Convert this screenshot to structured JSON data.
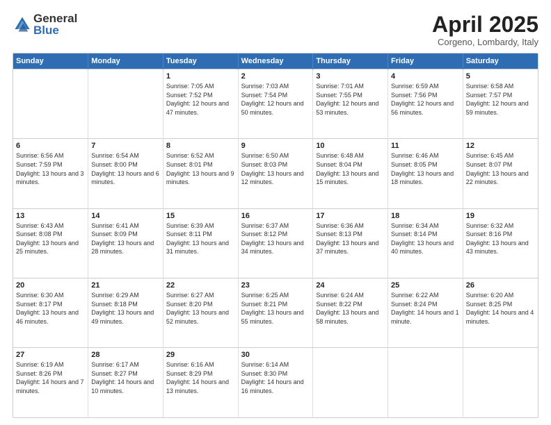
{
  "logo": {
    "general": "General",
    "blue": "Blue"
  },
  "title": "April 2025",
  "subtitle": "Corgeno, Lombardy, Italy",
  "days_of_week": [
    "Sunday",
    "Monday",
    "Tuesday",
    "Wednesday",
    "Thursday",
    "Friday",
    "Saturday"
  ],
  "weeks": [
    [
      {
        "day": "",
        "sunrise": "",
        "sunset": "",
        "daylight": ""
      },
      {
        "day": "",
        "sunrise": "",
        "sunset": "",
        "daylight": ""
      },
      {
        "day": "1",
        "sunrise": "Sunrise: 7:05 AM",
        "sunset": "Sunset: 7:52 PM",
        "daylight": "Daylight: 12 hours and 47 minutes."
      },
      {
        "day": "2",
        "sunrise": "Sunrise: 7:03 AM",
        "sunset": "Sunset: 7:54 PM",
        "daylight": "Daylight: 12 hours and 50 minutes."
      },
      {
        "day": "3",
        "sunrise": "Sunrise: 7:01 AM",
        "sunset": "Sunset: 7:55 PM",
        "daylight": "Daylight: 12 hours and 53 minutes."
      },
      {
        "day": "4",
        "sunrise": "Sunrise: 6:59 AM",
        "sunset": "Sunset: 7:56 PM",
        "daylight": "Daylight: 12 hours and 56 minutes."
      },
      {
        "day": "5",
        "sunrise": "Sunrise: 6:58 AM",
        "sunset": "Sunset: 7:57 PM",
        "daylight": "Daylight: 12 hours and 59 minutes."
      }
    ],
    [
      {
        "day": "6",
        "sunrise": "Sunrise: 6:56 AM",
        "sunset": "Sunset: 7:59 PM",
        "daylight": "Daylight: 13 hours and 3 minutes."
      },
      {
        "day": "7",
        "sunrise": "Sunrise: 6:54 AM",
        "sunset": "Sunset: 8:00 PM",
        "daylight": "Daylight: 13 hours and 6 minutes."
      },
      {
        "day": "8",
        "sunrise": "Sunrise: 6:52 AM",
        "sunset": "Sunset: 8:01 PM",
        "daylight": "Daylight: 13 hours and 9 minutes."
      },
      {
        "day": "9",
        "sunrise": "Sunrise: 6:50 AM",
        "sunset": "Sunset: 8:03 PM",
        "daylight": "Daylight: 13 hours and 12 minutes."
      },
      {
        "day": "10",
        "sunrise": "Sunrise: 6:48 AM",
        "sunset": "Sunset: 8:04 PM",
        "daylight": "Daylight: 13 hours and 15 minutes."
      },
      {
        "day": "11",
        "sunrise": "Sunrise: 6:46 AM",
        "sunset": "Sunset: 8:05 PM",
        "daylight": "Daylight: 13 hours and 18 minutes."
      },
      {
        "day": "12",
        "sunrise": "Sunrise: 6:45 AM",
        "sunset": "Sunset: 8:07 PM",
        "daylight": "Daylight: 13 hours and 22 minutes."
      }
    ],
    [
      {
        "day": "13",
        "sunrise": "Sunrise: 6:43 AM",
        "sunset": "Sunset: 8:08 PM",
        "daylight": "Daylight: 13 hours and 25 minutes."
      },
      {
        "day": "14",
        "sunrise": "Sunrise: 6:41 AM",
        "sunset": "Sunset: 8:09 PM",
        "daylight": "Daylight: 13 hours and 28 minutes."
      },
      {
        "day": "15",
        "sunrise": "Sunrise: 6:39 AM",
        "sunset": "Sunset: 8:11 PM",
        "daylight": "Daylight: 13 hours and 31 minutes."
      },
      {
        "day": "16",
        "sunrise": "Sunrise: 6:37 AM",
        "sunset": "Sunset: 8:12 PM",
        "daylight": "Daylight: 13 hours and 34 minutes."
      },
      {
        "day": "17",
        "sunrise": "Sunrise: 6:36 AM",
        "sunset": "Sunset: 8:13 PM",
        "daylight": "Daylight: 13 hours and 37 minutes."
      },
      {
        "day": "18",
        "sunrise": "Sunrise: 6:34 AM",
        "sunset": "Sunset: 8:14 PM",
        "daylight": "Daylight: 13 hours and 40 minutes."
      },
      {
        "day": "19",
        "sunrise": "Sunrise: 6:32 AM",
        "sunset": "Sunset: 8:16 PM",
        "daylight": "Daylight: 13 hours and 43 minutes."
      }
    ],
    [
      {
        "day": "20",
        "sunrise": "Sunrise: 6:30 AM",
        "sunset": "Sunset: 8:17 PM",
        "daylight": "Daylight: 13 hours and 46 minutes."
      },
      {
        "day": "21",
        "sunrise": "Sunrise: 6:29 AM",
        "sunset": "Sunset: 8:18 PM",
        "daylight": "Daylight: 13 hours and 49 minutes."
      },
      {
        "day": "22",
        "sunrise": "Sunrise: 6:27 AM",
        "sunset": "Sunset: 8:20 PM",
        "daylight": "Daylight: 13 hours and 52 minutes."
      },
      {
        "day": "23",
        "sunrise": "Sunrise: 6:25 AM",
        "sunset": "Sunset: 8:21 PM",
        "daylight": "Daylight: 13 hours and 55 minutes."
      },
      {
        "day": "24",
        "sunrise": "Sunrise: 6:24 AM",
        "sunset": "Sunset: 8:22 PM",
        "daylight": "Daylight: 13 hours and 58 minutes."
      },
      {
        "day": "25",
        "sunrise": "Sunrise: 6:22 AM",
        "sunset": "Sunset: 8:24 PM",
        "daylight": "Daylight: 14 hours and 1 minute."
      },
      {
        "day": "26",
        "sunrise": "Sunrise: 6:20 AM",
        "sunset": "Sunset: 8:25 PM",
        "daylight": "Daylight: 14 hours and 4 minutes."
      }
    ],
    [
      {
        "day": "27",
        "sunrise": "Sunrise: 6:19 AM",
        "sunset": "Sunset: 8:26 PM",
        "daylight": "Daylight: 14 hours and 7 minutes."
      },
      {
        "day": "28",
        "sunrise": "Sunrise: 6:17 AM",
        "sunset": "Sunset: 8:27 PM",
        "daylight": "Daylight: 14 hours and 10 minutes."
      },
      {
        "day": "29",
        "sunrise": "Sunrise: 6:16 AM",
        "sunset": "Sunset: 8:29 PM",
        "daylight": "Daylight: 14 hours and 13 minutes."
      },
      {
        "day": "30",
        "sunrise": "Sunrise: 6:14 AM",
        "sunset": "Sunset: 8:30 PM",
        "daylight": "Daylight: 14 hours and 16 minutes."
      },
      {
        "day": "",
        "sunrise": "",
        "sunset": "",
        "daylight": ""
      },
      {
        "day": "",
        "sunrise": "",
        "sunset": "",
        "daylight": ""
      },
      {
        "day": "",
        "sunrise": "",
        "sunset": "",
        "daylight": ""
      }
    ]
  ]
}
